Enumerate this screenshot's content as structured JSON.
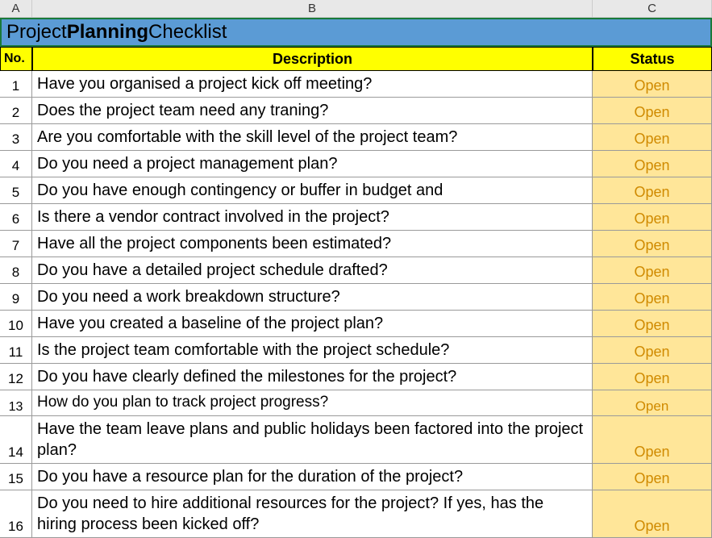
{
  "columns": {
    "a": "A",
    "b": "B",
    "c": "C"
  },
  "title": {
    "part1": "Project ",
    "bold": "Planning",
    "part2": " Checklist"
  },
  "headers": {
    "no": "No.",
    "description": "Description",
    "status": "Status"
  },
  "rows": [
    {
      "no": "1",
      "desc": "Have you organised a project kick off meeting?",
      "status": "Open",
      "cls": ""
    },
    {
      "no": "2",
      "desc": "Does the project team need any traning?",
      "status": "Open",
      "cls": ""
    },
    {
      "no": "3",
      "desc": "Are you comfortable with the skill level of the project team?",
      "status": "Open",
      "cls": ""
    },
    {
      "no": "4",
      "desc": "Do you need a project management plan?",
      "status": "Open",
      "cls": ""
    },
    {
      "no": "5",
      "desc": "Do you have enough contingency or buffer in budget and",
      "status": "Open",
      "cls": ""
    },
    {
      "no": "6",
      "desc": "Is there a vendor contract involved in the project?",
      "status": "Open",
      "cls": ""
    },
    {
      "no": "7",
      "desc": "Have all the project components been estimated?",
      "status": "Open",
      "cls": ""
    },
    {
      "no": "8",
      "desc": "Do you have a detailed project schedule drafted?",
      "status": "Open",
      "cls": ""
    },
    {
      "no": "9",
      "desc": "Do you need a work breakdown structure?",
      "status": "Open",
      "cls": ""
    },
    {
      "no": "10",
      "desc": "Have you created a baseline of the project plan?",
      "status": "Open",
      "cls": ""
    },
    {
      "no": "11",
      "desc": "Is the project team comfortable with the project schedule?",
      "status": "Open",
      "cls": ""
    },
    {
      "no": "12",
      "desc": "Do you have clearly defined the milestones for the project?",
      "status": "Open",
      "cls": ""
    },
    {
      "no": "13",
      "desc": "How do you plan to track project progress?",
      "status": "Open",
      "cls": "short"
    },
    {
      "no": "14",
      "desc": "Have the team leave plans and public holidays been factored into the project plan?",
      "status": "Open",
      "cls": "tall"
    },
    {
      "no": "15",
      "desc": "Do you have a resource plan for the duration of the project?",
      "status": "Open",
      "cls": ""
    },
    {
      "no": "16",
      "desc": "Do you need to hire additional resources for the project? If yes, has the hiring process been kicked off?",
      "status": "Open",
      "cls": "tall"
    }
  ]
}
